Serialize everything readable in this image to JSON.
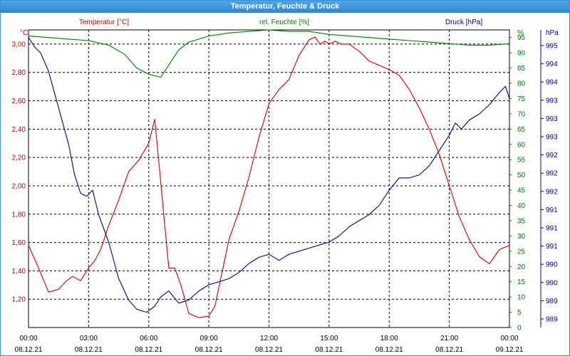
{
  "window": {
    "title": "Temperatur, Feuchte & Druck"
  },
  "chart_data": {
    "type": "line",
    "title": "Temperatur, Feuchte & Druck",
    "grid": true,
    "x_ticks": [
      {
        "time": "00:00",
        "date": "08.12.21"
      },
      {
        "time": "03:00",
        "date": "08.12.21"
      },
      {
        "time": "06:00",
        "date": "08.12.21"
      },
      {
        "time": "09:00",
        "date": "08.12.21"
      },
      {
        "time": "12:00",
        "date": "08.12.21"
      },
      {
        "time": "15:00",
        "date": "08.12.21"
      },
      {
        "time": "18:00",
        "date": "08.12.21"
      },
      {
        "time": "21:00",
        "date": "08.12.21"
      },
      {
        "time": "00:00",
        "date": "09.12.21"
      }
    ],
    "xlim_hours": [
      0,
      24
    ],
    "axes": {
      "temperature": {
        "label": "Temperatur [°C]",
        "unit": "°C",
        "color": "#cc0000",
        "ylim": [
          1.0,
          3.1
        ],
        "ticks": [
          1.2,
          1.4,
          1.6,
          1.8,
          2.0,
          2.2,
          2.4,
          2.6,
          2.8,
          3.0
        ],
        "tick_labels": [
          "1,20",
          "1,40",
          "1,60",
          "1,80",
          "2,00",
          "2,20",
          "2,40",
          "2,60",
          "2,80",
          "3,00"
        ]
      },
      "humidity": {
        "label": "rel. Feuchte [%]",
        "unit": "%",
        "color": "#007700",
        "ylim": [
          0,
          97.5
        ],
        "ticks": [
          0,
          5,
          10,
          15,
          20,
          25,
          30,
          35,
          40,
          45,
          50,
          55,
          60,
          65,
          70,
          75,
          80,
          85,
          90,
          95
        ],
        "tick_labels": [
          "0",
          "5",
          "10",
          "15",
          "20",
          "25",
          "30",
          "35",
          "40",
          "45",
          "50",
          "55",
          "60",
          "65",
          "70",
          "75",
          "80",
          "85",
          "90",
          "95"
        ],
        "extra_label": "%"
      },
      "pressure": {
        "label": "Druck [hPa]",
        "unit": "hPa",
        "color": "#00008b",
        "tick_labels": [
          "989",
          "989",
          "990",
          "990",
          "991",
          "991",
          "991",
          "992",
          "992",
          "992",
          "993",
          "993",
          "993",
          "994",
          "994",
          "995"
        ]
      }
    },
    "series": [
      {
        "name": "Temperatur [°C]",
        "axis": "temperature",
        "color": "#cc0000",
        "x": [
          0,
          0.5,
          1,
          1.5,
          1.9,
          2.2,
          2.6,
          3,
          3.3,
          3.6,
          4,
          4.5,
          5,
          5.5,
          6,
          6.3,
          6.55,
          6.8,
          7,
          7.3,
          7.6,
          8,
          8.5,
          9,
          9.3,
          9.6,
          10,
          10.5,
          11,
          11.5,
          12,
          12.5,
          13,
          13.5,
          14,
          14.3,
          14.55,
          14.8,
          15,
          15.3,
          15.6,
          16,
          16.5,
          17,
          17.5,
          18,
          18.5,
          19,
          19.5,
          20,
          20.5,
          21,
          21.5,
          22,
          22.5,
          23,
          23.5,
          24
        ],
        "y": [
          1.58,
          1.42,
          1.25,
          1.27,
          1.33,
          1.36,
          1.33,
          1.42,
          1.47,
          1.55,
          1.72,
          1.9,
          2.1,
          2.18,
          2.3,
          2.47,
          2.1,
          1.72,
          1.42,
          1.42,
          1.3,
          1.1,
          1.07,
          1.08,
          1.15,
          1.35,
          1.62,
          1.82,
          2.06,
          2.34,
          2.58,
          2.68,
          2.75,
          2.92,
          3.03,
          3.05,
          3.0,
          3.02,
          3.0,
          3.02,
          3.0,
          3.0,
          2.95,
          2.88,
          2.85,
          2.82,
          2.78,
          2.68,
          2.55,
          2.4,
          2.22,
          2.0,
          1.78,
          1.62,
          1.5,
          1.45,
          1.55,
          1.58
        ]
      },
      {
        "name": "rel. Feuchte [%]",
        "axis": "humidity",
        "color": "#007700",
        "x": [
          0,
          1,
          2,
          3,
          4,
          4.8,
          5.4,
          6,
          6.6,
          7,
          7.5,
          8,
          9,
          10,
          11,
          12,
          13,
          14,
          15,
          16,
          17,
          18,
          19,
          20,
          21,
          22,
          23,
          24
        ],
        "y": [
          95.5,
          95,
          94.5,
          94,
          92.5,
          89.5,
          85,
          83,
          82,
          86,
          91,
          93.5,
          95.5,
          96.5,
          97,
          97.5,
          97,
          97,
          96,
          95.5,
          95,
          94.5,
          94,
          93.5,
          93,
          92.5,
          92.5,
          93
        ]
      },
      {
        "name": "Druck [hPa]",
        "axis": "pressure",
        "color": "#00008b",
        "x": [
          0,
          0.3,
          0.6,
          1,
          1.5,
          2,
          2.3,
          2.6,
          2.9,
          3.2,
          3.5,
          4,
          4.5,
          5,
          5.4,
          5.9,
          6.3,
          6.6,
          7,
          7.5,
          8,
          8.5,
          9,
          9.5,
          10,
          10.5,
          11,
          11.5,
          12,
          12.5,
          13,
          13.5,
          14,
          14.5,
          15,
          15.5,
          16,
          16.5,
          17,
          17.5,
          18,
          18.5,
          19,
          19.5,
          20,
          20.5,
          21,
          21.3,
          21.6,
          22,
          22.5,
          23,
          23.5,
          23.8,
          24
        ],
        "y": [
          95,
          92,
          90,
          84,
          72,
          60,
          50,
          44,
          43,
          45,
          37,
          28,
          16,
          9,
          6,
          5,
          7,
          10,
          12,
          8,
          9,
          12,
          14,
          15,
          16,
          18,
          21,
          23,
          24,
          22,
          24,
          25,
          26,
          27,
          28,
          30,
          33,
          35,
          37,
          40,
          45,
          49,
          49,
          50,
          53,
          58,
          63,
          67,
          65,
          68,
          70,
          73,
          77,
          79,
          75
        ]
      }
    ]
  }
}
